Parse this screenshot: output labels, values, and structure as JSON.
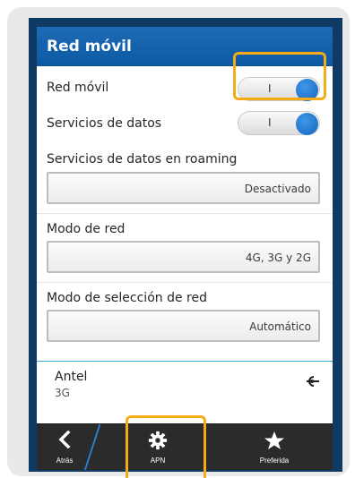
{
  "header": {
    "title": "Red móvil"
  },
  "settings": {
    "mobile_network": {
      "label": "Red móvil",
      "toggle_mark": "I",
      "on": true
    },
    "data_services": {
      "label": "Servicios de datos",
      "toggle_mark": "I",
      "on": true
    },
    "roaming_data": {
      "label": "Servicios de datos en roaming",
      "value": "Desactivado"
    },
    "network_mode": {
      "label": "Modo de red",
      "value": "4G, 3G y 2G"
    },
    "network_selection": {
      "label": "Modo de selección de red",
      "value": "Automático"
    }
  },
  "network": {
    "name": "Antel",
    "type": "3G",
    "icon": "network-connected-icon"
  },
  "bottom_bar": {
    "back": {
      "label": "Atrás",
      "icon": "chevron-left-icon"
    },
    "apn": {
      "label": "APN",
      "icon": "gear-icon"
    },
    "preferred": {
      "label": "Preferida",
      "icon": "star-icon"
    }
  },
  "colors": {
    "titlebar": "#1565b3",
    "toggle_knob": "#1d74cb",
    "highlight": "#f4ab14",
    "bottom_bar": "#2b2b2b",
    "frame": "#0f3a63"
  }
}
